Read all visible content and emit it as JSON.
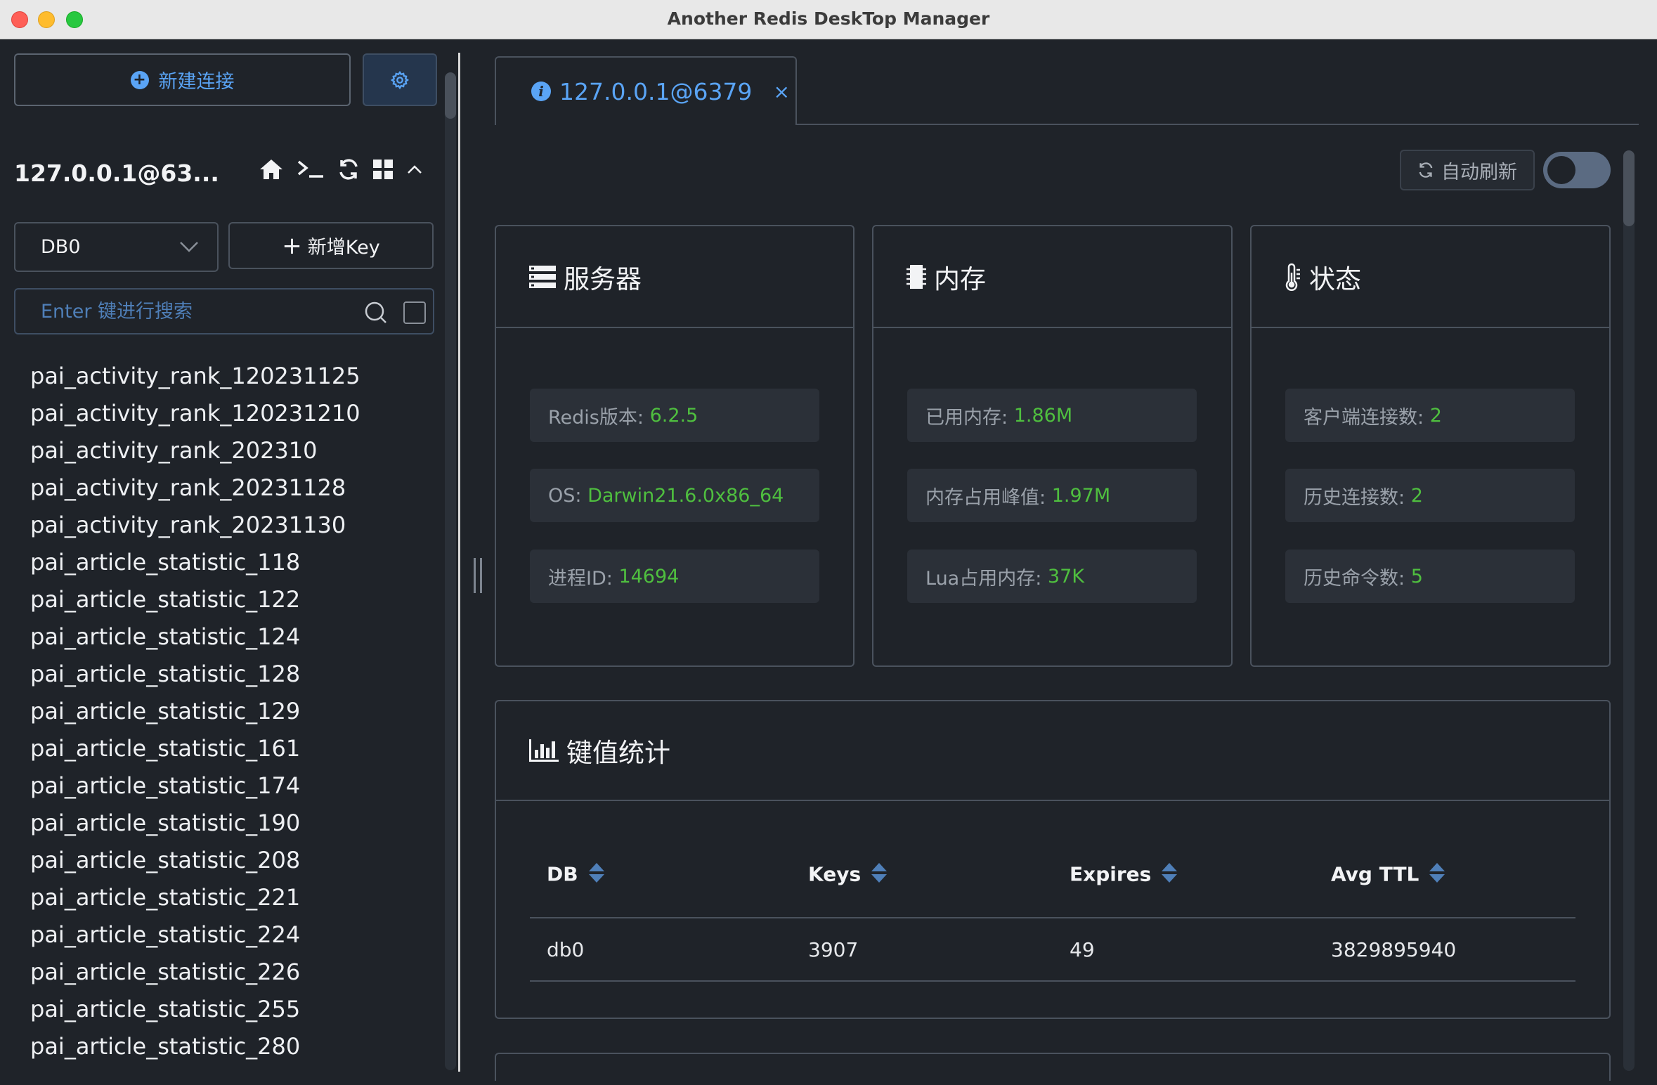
{
  "window": {
    "title": "Another Redis DeskTop Manager"
  },
  "sidebar": {
    "new_connection_label": "新建连接",
    "connection_name": "127.0.0.1@63...",
    "db_selected": "DB0",
    "add_key_label": "新增Key",
    "search_placeholder": "Enter 键进行搜索",
    "keys": [
      "pai_activity_rank_120231125",
      "pai_activity_rank_120231210",
      "pai_activity_rank_202310",
      "pai_activity_rank_20231128",
      "pai_activity_rank_20231130",
      "pai_article_statistic_118",
      "pai_article_statistic_122",
      "pai_article_statistic_124",
      "pai_article_statistic_128",
      "pai_article_statistic_129",
      "pai_article_statistic_161",
      "pai_article_statistic_174",
      "pai_article_statistic_190",
      "pai_article_statistic_208",
      "pai_article_statistic_221",
      "pai_article_statistic_224",
      "pai_article_statistic_226",
      "pai_article_statistic_255",
      "pai_article_statistic_280"
    ]
  },
  "main": {
    "tab_label": "127.0.0.1@6379",
    "tab_close": "×",
    "auto_refresh_label": "自动刷新",
    "auto_refresh_on": false,
    "server": {
      "title": "服务器",
      "redis_version_label": "Redis版本:",
      "redis_version": "6.2.5",
      "os_label": "OS:",
      "os": "Darwin21.6.0x86_64",
      "pid_label": "进程ID:",
      "pid": "14694"
    },
    "memory": {
      "title": "内存",
      "used_label": "已用内存:",
      "used": "1.86M",
      "peak_label": "内存占用峰值:",
      "peak": "1.97M",
      "lua_label": "Lua占用内存:",
      "lua": "37K"
    },
    "status": {
      "title": "状态",
      "clients_label": "客户端连接数:",
      "clients": "2",
      "history_conn_label": "历史连接数:",
      "history_conn": "2",
      "history_cmd_label": "历史命令数:",
      "history_cmd": "5"
    },
    "key_stats": {
      "title": "键值统计",
      "columns": [
        "DB",
        "Keys",
        "Expires",
        "Avg TTL"
      ],
      "rows": [
        [
          "db0",
          "3907",
          "49",
          "3829895940"
        ]
      ]
    }
  },
  "colors": {
    "accent": "#5aa4f5",
    "value_green": "#4fbf3f",
    "background": "#1f2329"
  }
}
